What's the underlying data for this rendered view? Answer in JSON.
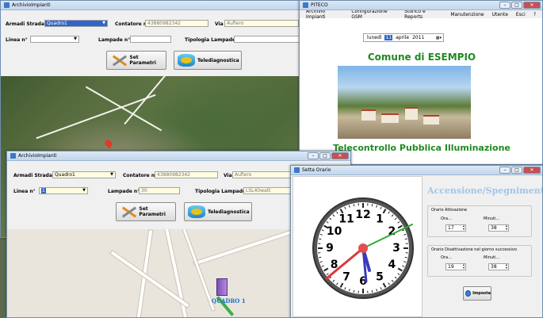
{
  "win_back": {
    "title": "ArchivioImpianti",
    "armadi_label": "Armadi Stradali",
    "armadi_value": "Quadro1",
    "contatore_label": "Contatore n°",
    "contatore_value": "43880982342",
    "via_label": "Via",
    "via_value": "Aufiero",
    "linea_label": "Linea n°",
    "lampade_label": "Lampade n°",
    "tipologia_label": "Tipologia Lampade",
    "set_btn": "Set Parametri",
    "tele_btn": "Telediagnostica"
  },
  "piteco": {
    "title": "PITECO",
    "menu": [
      "Archivio Impianti",
      "Configurazione GSM",
      "Storico e Reports",
      "Manutenzione",
      "Utente",
      "Esci",
      "?"
    ],
    "date_day": "lunedì",
    "date_num": "11",
    "date_month": "aprile",
    "date_year": "2011",
    "comune": "Comune di ESEMPIO",
    "telecontrollo": "Telecontrollo Pubblica Illuminazione"
  },
  "win_front": {
    "title": "ArchivioImpianti",
    "armadi_label": "Armadi Stradali",
    "armadi_value": "Quadro1",
    "contatore_label": "Contatore n°",
    "contatore_value": "43880982342",
    "via_label": "Via",
    "via_value": "Aufiero",
    "linea_label": "Linea n°",
    "linea_value": "1",
    "lampade_label": "Lampade n°",
    "lampade_value": "30",
    "tipologia_label": "Tipologia Lampade",
    "tipologia_value": "LSL40watt",
    "set_btn": "Set Parametri",
    "tele_btn": "Telediagnostica",
    "map_label": "QUADRO 1"
  },
  "orario": {
    "title": "Setta Orario",
    "heading": "Accensione/Spegnimento",
    "attivazione_label": "Orario Attivazione",
    "ora_label": "Ora...",
    "minuti_label": "Minuti...",
    "att_ora": "17",
    "att_min": "38",
    "disatt_label": "Orario Disattivazione nel giorno successivo",
    "dis_ora": "19",
    "dis_min": "38",
    "imposta_btn": "Imposta",
    "clock_numbers": [
      "12",
      "1",
      "2",
      "3",
      "4",
      "5",
      "6",
      "7",
      "8",
      "9",
      "10",
      "11"
    ]
  },
  "colors": {
    "green_title": "#1f8a1f",
    "heading_blue": "#9fc6ea",
    "selection": "#3166c8"
  }
}
